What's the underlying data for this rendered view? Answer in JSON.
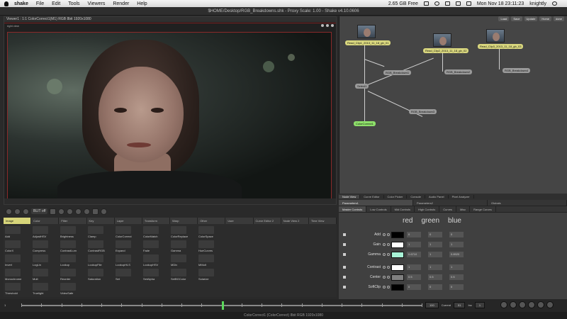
{
  "menubar": {
    "app_name": "shake",
    "items": [
      "File",
      "Edit",
      "Tools",
      "Viewers",
      "Render",
      "Help"
    ],
    "disk_free": "2.65 GB Free",
    "datetime": "Mon Nov 18  23:11:23",
    "user": "knightly"
  },
  "window": {
    "title": "$HOME/Desktop/RGB_Breakdowns.shk - Proxy Scale: 1.00 - Shake v4.10.0606"
  },
  "viewer": {
    "header": "Viewer1 : 1:1 ColorCorrect1(M1) RGB 8bit 1920x1080",
    "corner_label": "right view"
  },
  "viewer_tools": {
    "blit_label": "BLIT off"
  },
  "node_graph": {
    "top_buttons": [
      "Load",
      "Save",
      "Update",
      "Home",
      "done"
    ],
    "nodes": [
      {
        "id": "read1",
        "label": "Read_Clip1_2013_11_18_gb_01"
      },
      {
        "id": "read2",
        "label": "Read_Clip2_2013_11_18_gb_02"
      },
      {
        "id": "read3",
        "label": "Read_Clip3_2013_11_18_gb_03"
      },
      {
        "id": "rgb1",
        "label": "RGB_Breakdown1"
      },
      {
        "id": "rgb2",
        "label": "RGB_Breakdown2"
      },
      {
        "id": "rgb3",
        "label": "RGB_Breakdown3"
      },
      {
        "id": "rgb4",
        "label": "RGB_Breakdown4"
      },
      {
        "id": "select",
        "label": "Select1"
      },
      {
        "id": "cc",
        "label": "ColorCorrect1"
      }
    ]
  },
  "panel_tabs": [
    "Node View",
    "Curve Editor",
    "Color Picker",
    "Console",
    "Audio Panel",
    "Pixel Analyzer"
  ],
  "param_tabs": {
    "top": [
      "Parameters1",
      "Parameters2",
      "Globals"
    ],
    "sub": [
      "Master Controls",
      "Low Controls",
      "Mid Controls",
      "High Controls",
      "Curves",
      "Misc",
      "Range Curves"
    ]
  },
  "param_headers": {
    "red": "red",
    "green": "green",
    "blue": "blue"
  },
  "params": [
    {
      "label": "Add",
      "swatch": "#000000",
      "r": "0",
      "g": "0",
      "b": "0"
    },
    {
      "label": "Gain",
      "swatch": "#ffffff",
      "r": "1",
      "g": "1",
      "b": "1"
    },
    {
      "label": "Gamma",
      "swatch": "#a8f2d6",
      "r": "0.6710",
      "g": "1",
      "b": "0.8920"
    },
    {
      "label": "Contrast",
      "swatch": "#ffffff",
      "r": "1",
      "g": "1",
      "b": "1"
    },
    {
      "label": "Center",
      "swatch": "#808080",
      "r": "0.5",
      "g": "0.5",
      "b": "0.5"
    },
    {
      "label": "SoftClip",
      "swatch": "#000000",
      "r": "0",
      "g": "0",
      "b": "0"
    }
  ],
  "shelf_tabs": [
    "Image",
    "Color",
    "Filter",
    "Key",
    "Layer",
    "Transform",
    "Warp",
    "Other",
    "User",
    "Curve Editor 2",
    "Node View 2",
    "Time View"
  ],
  "tools": [
    "Add",
    "AdjustHSV",
    "Brightness",
    "Clamp",
    "ColorCorrect",
    "ColorMatch",
    "ColorReplace",
    "ColorSpace",
    "",
    "ColorX",
    "Compress",
    "ContrastLum",
    "ContrastRGB",
    "Expand",
    "Fade",
    "Gamma",
    "HueCurves",
    "",
    "Invert",
    "LogLin",
    "Lookup",
    "LookupFile",
    "LookupHLS",
    "LookupHSV",
    "MDiv",
    "MMult",
    "",
    "Monochrome",
    "Mult",
    "Reorder",
    "Saturation",
    "Set",
    "SetAlpha",
    "SetBGColor",
    "Solarize",
    "",
    "Threshold",
    "Truelight",
    "VideoSafe",
    "",
    "",
    "",
    "",
    "",
    ""
  ],
  "timeline": {
    "start": "1",
    "end": "100",
    "current_label": "Current",
    "current": "51",
    "inc_label": "Inc",
    "inc": "1"
  },
  "status": "ColorCorrect1 (ColorCorrect) 8bit RGB 1920x1080"
}
